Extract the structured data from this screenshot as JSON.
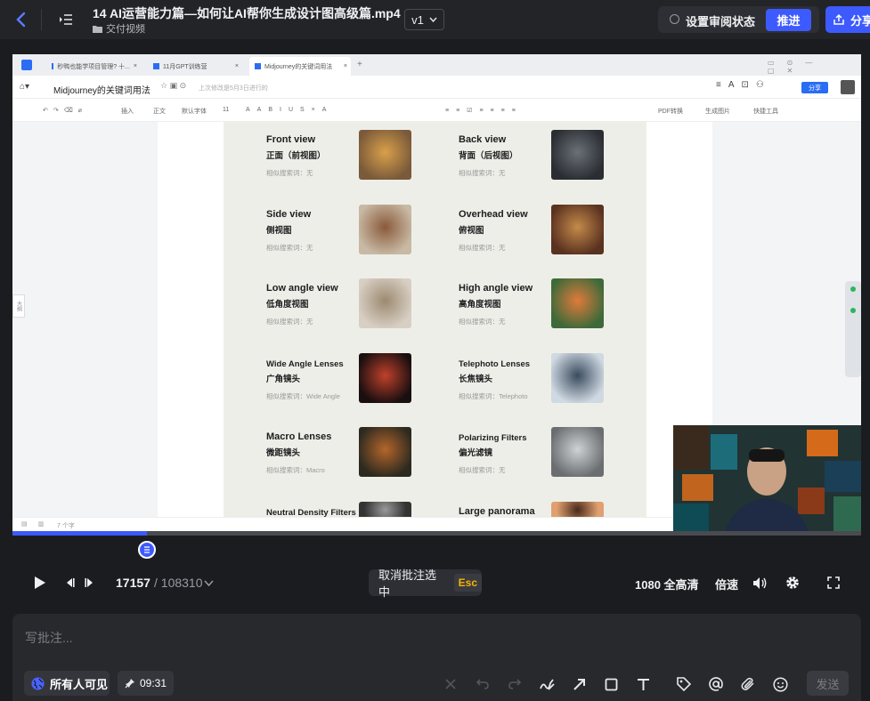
{
  "header": {
    "title": "14 AI运营能力篇—如何让AI帮你生成设计图高级篇.mp4",
    "folder": "交付视频",
    "version": "v1",
    "review_status": "设置审阅状态",
    "push": "推进",
    "share": "分享"
  },
  "browser": {
    "tabs": [
      {
        "label": "秒鸭也能学项目管理? 十..."
      },
      {
        "label": "11月GPT训练营"
      },
      {
        "label": "Midjourney的关键词用法"
      }
    ]
  },
  "doc": {
    "title": "Midjourney的关键词用法",
    "saved": "上次修改是5月3日进行的",
    "share": "分享",
    "toolbar": {
      "insert": "插入",
      "body": "正文",
      "font": "默认字体",
      "size": "11",
      "pdf": "PDF转换",
      "gen_image": "生成图片",
      "quick_tools": "快捷工具"
    },
    "side_tab": "大纲",
    "bottom_words": "7 个字",
    "views": [
      {
        "en": "Front view",
        "cn": "正面（前视图）",
        "sim": "相似搜索词：无",
        "col": 0,
        "row": 0
      },
      {
        "en": "Back view",
        "cn": "背面（后视图）",
        "sim": "相似搜索词：无",
        "col": 1,
        "row": 0
      },
      {
        "en": "Side view",
        "cn": "侧视图",
        "sim": "相似搜索词：无",
        "col": 0,
        "row": 1
      },
      {
        "en": "Overhead view",
        "cn": "俯视图",
        "sim": "相似搜索词：无",
        "col": 1,
        "row": 1
      },
      {
        "en": "Low angle view",
        "cn": "低角度视图",
        "sim": "相似搜索词：无",
        "col": 0,
        "row": 2
      },
      {
        "en": "High angle view",
        "cn": "高角度视图",
        "sim": "相似搜索词：无",
        "col": 1,
        "row": 2
      },
      {
        "en": "Wide Angle Lenses",
        "cn": "广角镜头",
        "sim": "相似搜索词：Wide Angle",
        "col": 0,
        "row": 3
      },
      {
        "en": "Telephoto Lenses",
        "cn": "长焦镜头",
        "sim": "相似搜索词：Telephoto",
        "col": 1,
        "row": 3
      },
      {
        "en": "Macro Lenses",
        "cn": "微距镜头",
        "sim": "相似搜索词：Macro",
        "col": 0,
        "row": 4
      },
      {
        "en": "Polarizing Filters",
        "cn": "偏光滤镜",
        "sim": "相似搜索词：无",
        "col": 1,
        "row": 4
      },
      {
        "en": "Neutral Density Filters",
        "cn": "",
        "sim": "",
        "col": 0,
        "row": 5
      },
      {
        "en": "Large panorama",
        "cn": "",
        "sim": "",
        "col": 1,
        "row": 5
      }
    ]
  },
  "player": {
    "progress": 0.1584,
    "frame_current": "17157",
    "frame_total": "/ 108310",
    "cancel_selection": "取消批注选中",
    "esc": "Esc",
    "quality": "1080 全高清",
    "speed": "倍速"
  },
  "comment": {
    "placeholder": "写批注...",
    "visibility": "所有人可见",
    "timestamp": "09:31",
    "send": "发送"
  },
  "colors": {
    "accent": "#3d5afe",
    "esc": "#f5b400",
    "bg": "#1b1c1f"
  }
}
